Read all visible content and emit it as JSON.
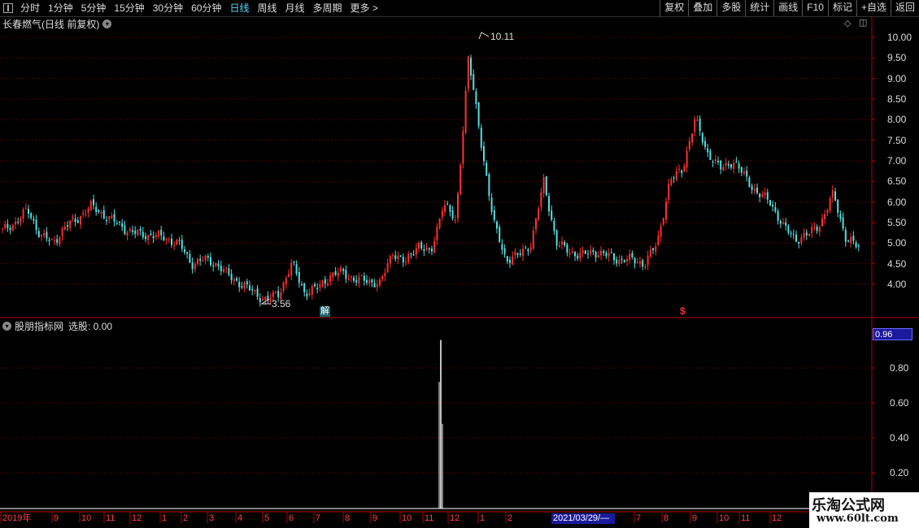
{
  "toolbar": {
    "periods": [
      "分时",
      "1分钟",
      "5分钟",
      "15分钟",
      "30分钟",
      "60分钟",
      "日线",
      "周线",
      "月线",
      "多周期",
      "更多 >"
    ],
    "active_period": "日线",
    "actions": [
      "复权",
      "叠加",
      "多股",
      "统计",
      "画线",
      "F10",
      "标记",
      "+自选",
      "返回"
    ]
  },
  "main_chart": {
    "title": "长春燃气(日线 前复权)",
    "y_ticks": [
      "10.00",
      "9.50",
      "9.00",
      "8.50",
      "8.00",
      "7.50",
      "7.00",
      "6.50",
      "6.00",
      "5.50",
      "5.00",
      "4.50",
      "4.00"
    ],
    "high_marker": "10.11",
    "low_marker": "3.56",
    "event_badge_1": "解",
    "event_badge_2": "$",
    "colors": {
      "up": "#ff3030",
      "down": "#54e0e0",
      "grid": "#8b0000"
    }
  },
  "indicator_pane": {
    "title": "股朋指标网",
    "value_label": "选股: 0.00",
    "current_value": "0.96",
    "y_ticks": [
      "0.80",
      "0.60",
      "0.40",
      "0.20"
    ],
    "signal_value": 0.96
  },
  "date_axis": {
    "labels": [
      "2019年",
      "9",
      "10",
      "11",
      "12",
      "1",
      "2",
      "3",
      "4",
      "5",
      "6",
      "7",
      "8",
      "9",
      "10",
      "11",
      "12",
      "1",
      "2",
      "7",
      "8",
      "9",
      "10",
      "11",
      "12"
    ],
    "cursor_date": "2021/03/29/—"
  },
  "watermark": {
    "title": "乐淘公式网",
    "url": "www.60lt.com"
  },
  "chart_data": {
    "type": "candlestick",
    "title": "长春燃气(日线 前复权)",
    "ylim": [
      3.3,
      10.3
    ],
    "series": [
      {
        "name": "close",
        "values": [
          5.3,
          5.5,
          5.8,
          5.2,
          5.0,
          5.4,
          5.6,
          5.9,
          5.7,
          5.5,
          5.3,
          5.2,
          5.2,
          5.1,
          5.0,
          4.5,
          4.6,
          4.5,
          4.2,
          4.0,
          3.8,
          3.6,
          3.8,
          4.5,
          3.8,
          3.9,
          4.2,
          4.3,
          4.1,
          4.1,
          4.0,
          4.8,
          4.5,
          5.0,
          4.7,
          6.0,
          5.5,
          9.5,
          7.5,
          5.5,
          4.6,
          4.7,
          5.0,
          6.5,
          5.0,
          4.8,
          4.7,
          4.8,
          4.7,
          4.6,
          4.6,
          4.5,
          5.0,
          6.5,
          6.8,
          8.0,
          7.2,
          6.8,
          7.0,
          6.6,
          6.2,
          6.0,
          5.4,
          5.1,
          5.2,
          5.5,
          6.2,
          5.1,
          4.9
        ]
      }
    ]
  }
}
